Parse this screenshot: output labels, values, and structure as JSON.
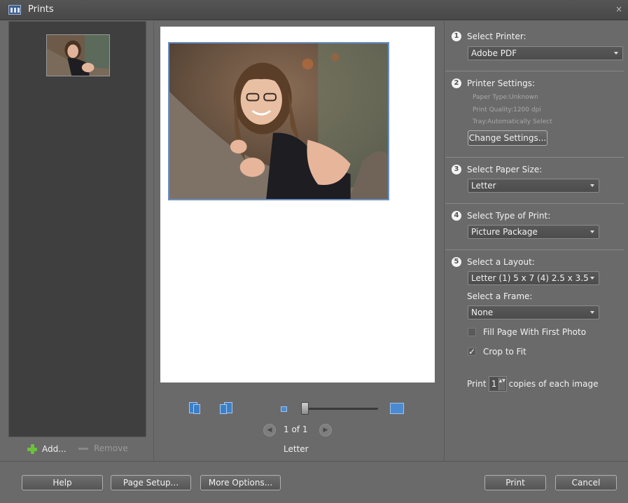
{
  "window": {
    "title": "Prints",
    "close_glyph": "×"
  },
  "left_panel": {
    "add_label": "Add...",
    "remove_label": "Remove"
  },
  "preview": {
    "page_indicator": "1 of 1",
    "paper_label": "Letter",
    "prev_glyph": "◀",
    "next_glyph": "▶"
  },
  "steps": {
    "printer": {
      "number": "1",
      "title": "Select Printer:",
      "value": "Adobe PDF"
    },
    "settings": {
      "number": "2",
      "title": "Printer Settings:",
      "paper_type": "Paper Type:Unknown",
      "print_quality": "Print Quality:1200 dpi",
      "tray": "Tray:Automatically Select",
      "change_button": "Change Settings..."
    },
    "paper_size": {
      "number": "3",
      "title": "Select Paper Size:",
      "value": "Letter"
    },
    "print_type": {
      "number": "4",
      "title": "Select Type of Print:",
      "value": "Picture Package"
    },
    "layout": {
      "number": "5",
      "title": "Select a Layout:",
      "value": "Letter (1) 5 x 7 (4) 2.5 x 3.5",
      "frame_title": "Select a Frame:",
      "frame_value": "None",
      "fill_page_label": "Fill Page With First Photo",
      "fill_page_checked": false,
      "crop_label": "Crop to Fit",
      "crop_checked": true,
      "check_glyph": "✓"
    },
    "copies": {
      "prefix": "Print",
      "value": "1",
      "suffix": "copies of each image",
      "stepper_glyph": "▲▼"
    }
  },
  "footer": {
    "help": "Help",
    "page_setup": "Page Setup...",
    "more_options": "More Options...",
    "print": "Print",
    "cancel": "Cancel"
  },
  "colors": {
    "accent_blue": "#3c7fc9",
    "add_green": "#6cc23a",
    "photo_border": "#6b8fc4"
  }
}
